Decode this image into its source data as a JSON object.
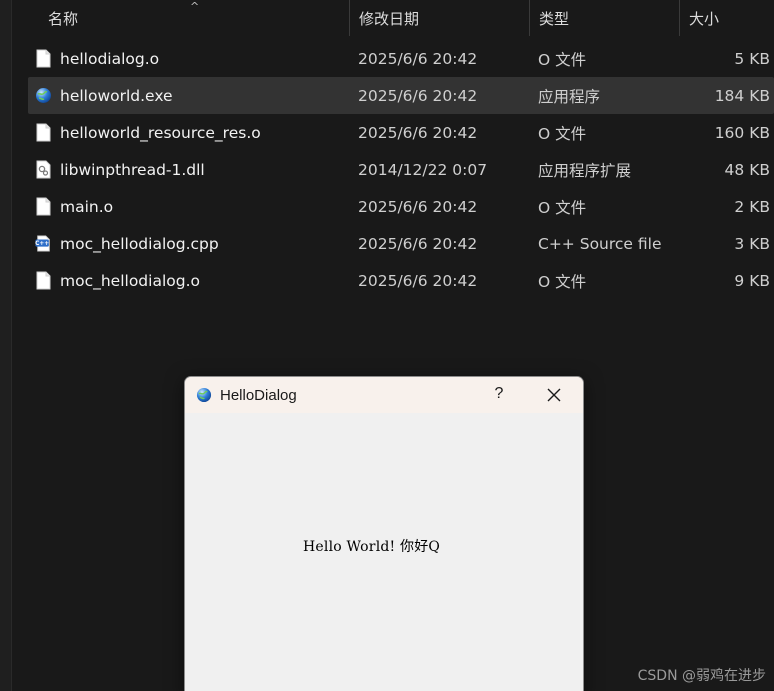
{
  "columns": {
    "name": "名称",
    "date": "修改日期",
    "type": "类型",
    "size": "大小"
  },
  "sort_caret": "^",
  "files": [
    {
      "name": "hellodialog.o",
      "date": "2025/6/6 20:42",
      "type": "O 文件",
      "size": "5 KB",
      "icon": "blank-file-icon",
      "selected": false
    },
    {
      "name": "helloworld.exe",
      "date": "2025/6/6 20:42",
      "type": "应用程序",
      "size": "184 KB",
      "icon": "app-globe-icon",
      "selected": true
    },
    {
      "name": "helloworld_resource_res.o",
      "date": "2025/6/6 20:42",
      "type": "O 文件",
      "size": "160 KB",
      "icon": "blank-file-icon",
      "selected": false
    },
    {
      "name": "libwinpthread-1.dll",
      "date": "2014/12/22 0:07",
      "type": "应用程序扩展",
      "size": "48 KB",
      "icon": "dll-file-icon",
      "selected": false
    },
    {
      "name": "main.o",
      "date": "2025/6/6 20:42",
      "type": "O 文件",
      "size": "2 KB",
      "icon": "blank-file-icon",
      "selected": false
    },
    {
      "name": "moc_hellodialog.cpp",
      "date": "2025/6/6 20:42",
      "type": "C++ Source file",
      "size": "3 KB",
      "icon": "cpp-file-icon",
      "selected": false
    },
    {
      "name": "moc_hellodialog.o",
      "date": "2025/6/6 20:42",
      "type": "O 文件",
      "size": "9 KB",
      "icon": "blank-file-icon",
      "selected": false
    }
  ],
  "dialog": {
    "title": "HelloDialog",
    "help": "?",
    "label": "Hello World! 你好Q"
  },
  "watermark": "CSDN @弱鸡在进步",
  "colors": {
    "background": "#191919",
    "selected_row": "#333333",
    "dialog_body": "#f0f0f0",
    "dialog_titlebar": "#f8f1ec"
  }
}
